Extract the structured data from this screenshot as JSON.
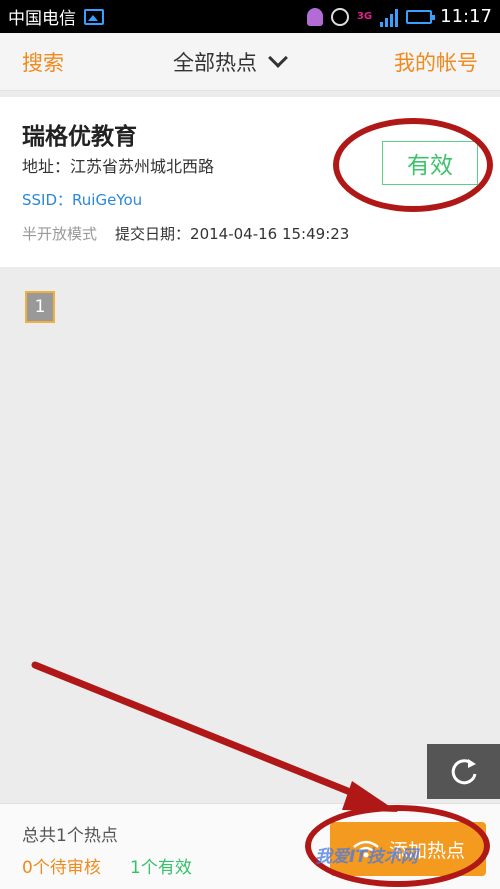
{
  "status_bar": {
    "carrier": "中国电信",
    "network": "3G",
    "time": "11:17"
  },
  "header": {
    "search_label": "搜索",
    "filter_label": "全部热点",
    "account_label": "我的帐号"
  },
  "hotspot": {
    "name": "瑞格优教育",
    "address": "地址：江苏省苏州城北西路",
    "ssid": "SSID：RuiGeYou",
    "mode": "半开放模式",
    "date_label": "提交日期：",
    "date": "2014-04-16 15:49:23",
    "status": "有效"
  },
  "pagination": {
    "current_page": "1"
  },
  "footer": {
    "total": "总共1个热点",
    "pending": "0个待审核",
    "valid": "1个有效",
    "add_button": "添加热点"
  },
  "watermark": "我爱IT技术网",
  "colors": {
    "accent_orange": "#f08a1c",
    "valid_green": "#37c06a",
    "link_blue": "#2b88d8",
    "annotation_red": "#b01818"
  }
}
